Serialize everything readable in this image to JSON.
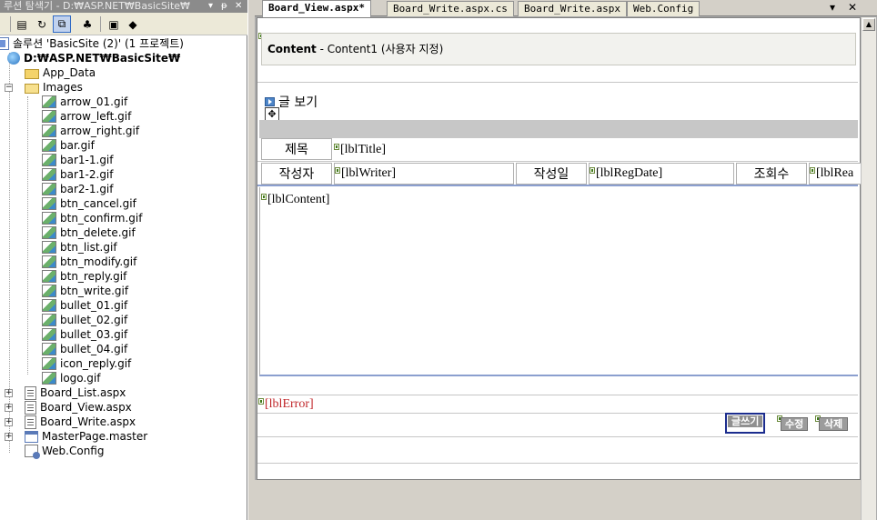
{
  "solution_explorer": {
    "title": "루션 탐색기 - D:₩ASP.NET₩BasicSite₩",
    "title_controls": [
      "▾",
      "ᵽ",
      "✕"
    ],
    "solution_label": "솔루션 'BasicSite (2)' (1 프로젝트)",
    "project_label": "D:₩ASP.NET₩BasicSite₩",
    "folders": {
      "app_data": "App_Data",
      "images": "Images"
    },
    "images": [
      "arrow_01.gif",
      "arrow_left.gif",
      "arrow_right.gif",
      "bar.gif",
      "bar1-1.gif",
      "bar1-2.gif",
      "bar2-1.gif",
      "btn_cancel.gif",
      "btn_confirm.gif",
      "btn_delete.gif",
      "btn_list.gif",
      "btn_modify.gif",
      "btn_reply.gif",
      "btn_write.gif",
      "bullet_01.gif",
      "bullet_02.gif",
      "bullet_03.gif",
      "bullet_04.gif",
      "icon_reply.gif",
      "logo.gif"
    ],
    "files": {
      "board_list": "Board_List.aspx",
      "board_view": "Board_View.aspx",
      "board_write": "Board_Write.aspx",
      "master": "MasterPage.master",
      "web_config": "Web.Config"
    }
  },
  "tabs": [
    {
      "label": "Board_View.aspx*",
      "active": true
    },
    {
      "label": "Board_Write.aspx.cs",
      "active": false
    },
    {
      "label": "Board_Write.aspx",
      "active": false
    },
    {
      "label": "Web.Config",
      "active": false
    }
  ],
  "tab_controls": {
    "menu": "▾",
    "close": "✕"
  },
  "designer": {
    "content_label": "Content",
    "content_desc": " - Content1 (사용자 지정)",
    "view_title": "글 보기",
    "row1": {
      "title_label": "제목",
      "title_field": "lblTitle"
    },
    "row2": {
      "writer_label": "작성자",
      "writer_field": "lblWriter",
      "regdate_label": "작성일",
      "regdate_field": "lblRegDate",
      "readcount_label": "조회수",
      "readcount_field": "lblRea"
    },
    "content_field": "lblContent",
    "error_field": "lblError",
    "buttons": {
      "write": "글쓰기",
      "modify": "수정",
      "delete": "삭제"
    }
  },
  "colors": {
    "accent": "#1c2d8e",
    "error": "#c0262a",
    "divider": "#8b9fcf"
  }
}
